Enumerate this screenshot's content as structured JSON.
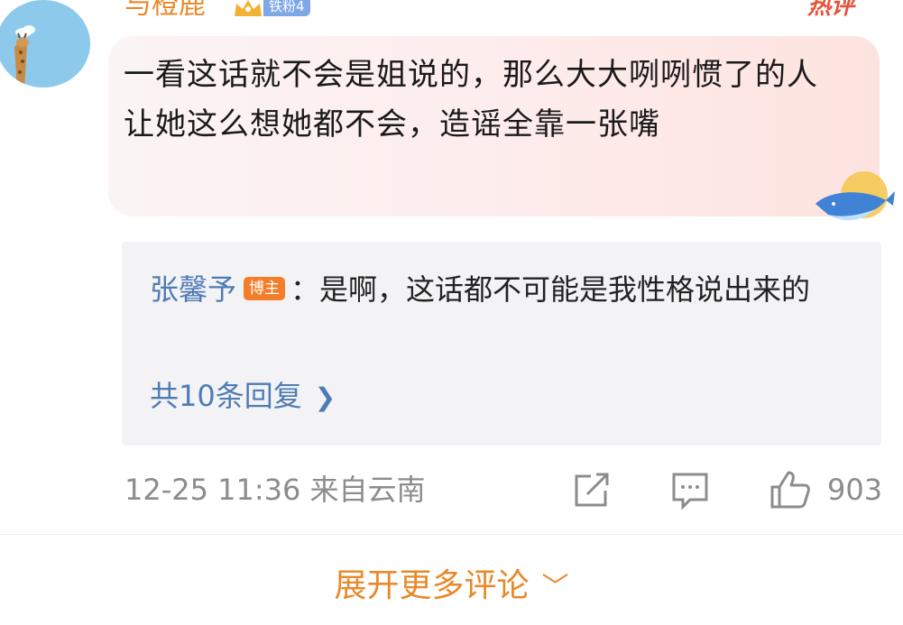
{
  "comment": {
    "username": "与橙鹿",
    "fan_badge": "铁粉4",
    "hot_label": "热评",
    "text": "一看这话就不会是姐说的，那么大大咧咧惯了的人让她这么想她都不会，造谣全靠一张嘴",
    "timestamp": "12-25 11:36",
    "location": "来自云南",
    "like_count": "903"
  },
  "reply": {
    "author": "张馨予",
    "author_badge": "博主",
    "text": "：是啊，这话都不可能是我性格说出来的",
    "count_label": "共10条回复"
  },
  "footer": {
    "expand_label": "展开更多评论"
  },
  "icons": {
    "reply_chevron": "chevron-right-icon",
    "expand_chevron": "chevron-down-icon",
    "share": "share-icon",
    "comment": "comment-icon",
    "like": "thumbs-up-icon"
  },
  "colors": {
    "accent_orange": "#e8892a",
    "link_blue": "#4f7bb5",
    "meta_gray": "#8c8c8c",
    "hot_red": "#e8533b"
  }
}
